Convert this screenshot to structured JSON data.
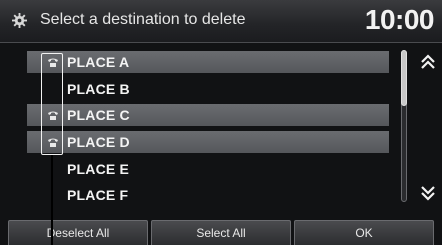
{
  "header": {
    "title": "Select a destination to delete",
    "clock": "10:00",
    "icon": "gear-icon"
  },
  "list": {
    "items": [
      {
        "label": "PLACE A",
        "selected": true,
        "icon": "phone-icon"
      },
      {
        "label": "PLACE B",
        "selected": false,
        "icon": null
      },
      {
        "label": "PLACE C",
        "selected": true,
        "icon": "phone-icon"
      },
      {
        "label": "PLACE D",
        "selected": true,
        "icon": "phone-icon"
      },
      {
        "label": "PLACE E",
        "selected": false,
        "icon": null
      },
      {
        "label": "PLACE F",
        "selected": false,
        "icon": null
      }
    ]
  },
  "scroll": {
    "up_icon": "double-chevron-up-icon",
    "down_icon": "double-chevron-down-icon"
  },
  "footer": {
    "deselect_all": "Deselect All",
    "select_all": "Select All",
    "ok": "OK"
  },
  "colors": {
    "background": "#111214",
    "row_highlight": "#5f6165",
    "text": "#f4f4f4"
  }
}
